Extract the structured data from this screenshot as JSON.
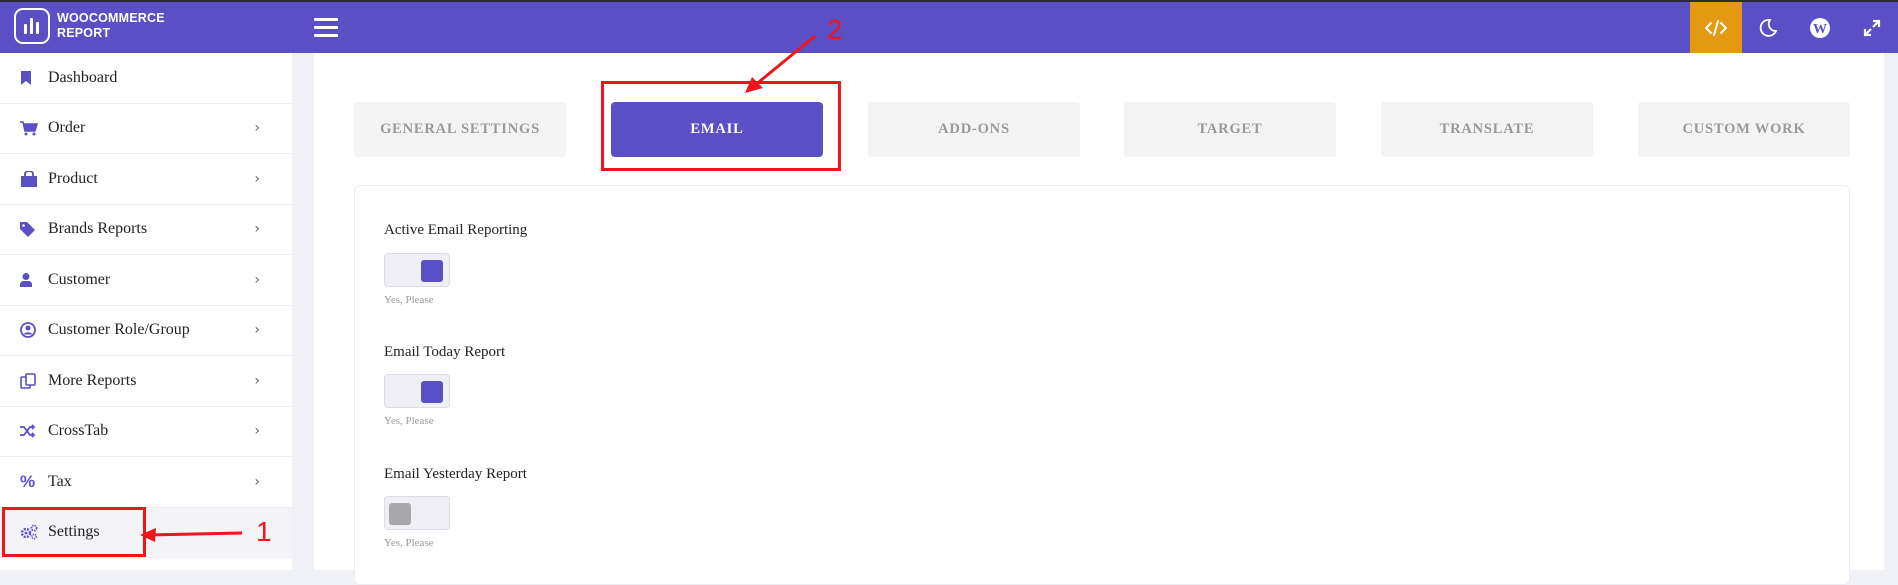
{
  "header": {
    "brand_line1": "WOOCOMMERCE",
    "brand_line2": "REPORT",
    "icons": [
      "code-icon",
      "moon-icon",
      "wordpress-icon",
      "fullscreen-icon"
    ],
    "accent_color": "#5a4fc4",
    "code_button_color": "#e39a12"
  },
  "sidebar": {
    "items": [
      {
        "label": "Dashboard",
        "icon": "bookmark-icon",
        "has_submenu": false
      },
      {
        "label": "Order",
        "icon": "cart-icon",
        "has_submenu": true
      },
      {
        "label": "Product",
        "icon": "shopping-bag-icon",
        "has_submenu": true
      },
      {
        "label": "Brands Reports",
        "icon": "tag-icon",
        "has_submenu": true
      },
      {
        "label": "Customer",
        "icon": "user-icon",
        "has_submenu": true
      },
      {
        "label": "Customer Role/Group",
        "icon": "user-circle-icon",
        "has_submenu": true
      },
      {
        "label": "More Reports",
        "icon": "copy-icon",
        "has_submenu": true
      },
      {
        "label": "CrossTab",
        "icon": "shuffle-icon",
        "has_submenu": true
      },
      {
        "label": "Tax",
        "icon": "percent-icon",
        "has_submenu": true
      },
      {
        "label": "Settings",
        "icon": "cogs-icon",
        "has_submenu": false,
        "active": true
      }
    ]
  },
  "tabs": [
    {
      "label": "GENERAL SETTINGS",
      "active": false
    },
    {
      "label": "EMAIL",
      "active": true
    },
    {
      "label": "ADD-ONS",
      "active": false
    },
    {
      "label": "TARGET",
      "active": false
    },
    {
      "label": "TRANSLATE",
      "active": false
    },
    {
      "label": "CUSTOM WORK",
      "active": false
    }
  ],
  "email_settings": [
    {
      "label": "Active Email Reporting",
      "enabled": true,
      "hint": "Yes, Please"
    },
    {
      "label": "Email Today Report",
      "enabled": true,
      "hint": "Yes, Please"
    },
    {
      "label": "Email Yesterday Report",
      "enabled": false,
      "hint": "Yes, Please"
    }
  ],
  "annotations": [
    {
      "number": "1",
      "target": "Settings"
    },
    {
      "number": "2",
      "target": "EMAIL"
    }
  ]
}
